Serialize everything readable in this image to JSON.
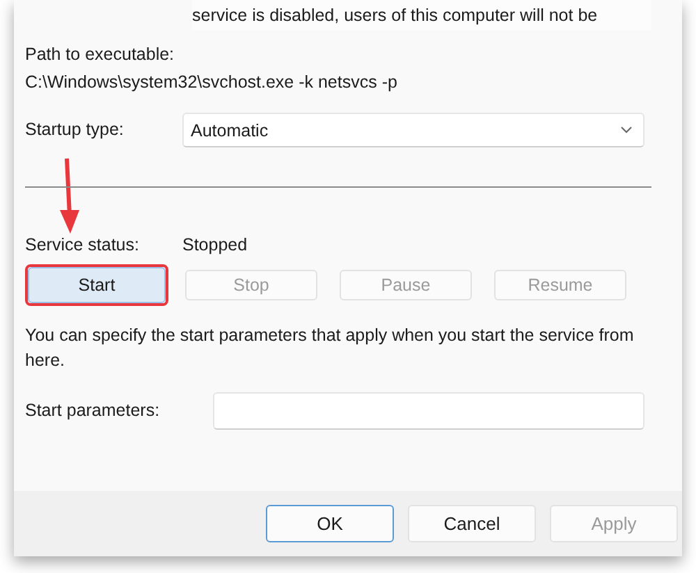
{
  "description_fragment": "service is disabled, users of this computer will not be",
  "path": {
    "label": "Path to executable:",
    "value": "C:\\Windows\\system32\\svchost.exe -k netsvcs -p"
  },
  "startup_type": {
    "label": "Startup type:",
    "value": "Automatic"
  },
  "service_status": {
    "label": "Service status:",
    "value": "Stopped"
  },
  "service_buttons": [
    {
      "label": "Start",
      "disabled": false,
      "highlighted": true
    },
    {
      "label": "Stop",
      "disabled": true,
      "highlighted": false
    },
    {
      "label": "Pause",
      "disabled": true,
      "highlighted": false
    },
    {
      "label": "Resume",
      "disabled": true,
      "highlighted": false
    }
  ],
  "hint": "You can specify the start parameters that apply when you start the service from here.",
  "start_parameters": {
    "label": "Start parameters:"
  },
  "dialog_buttons": [
    {
      "label": "OK",
      "disabled": false,
      "default": true
    },
    {
      "label": "Cancel",
      "disabled": false,
      "default": false
    },
    {
      "label": "Apply",
      "disabled": true,
      "default": false
    }
  ]
}
